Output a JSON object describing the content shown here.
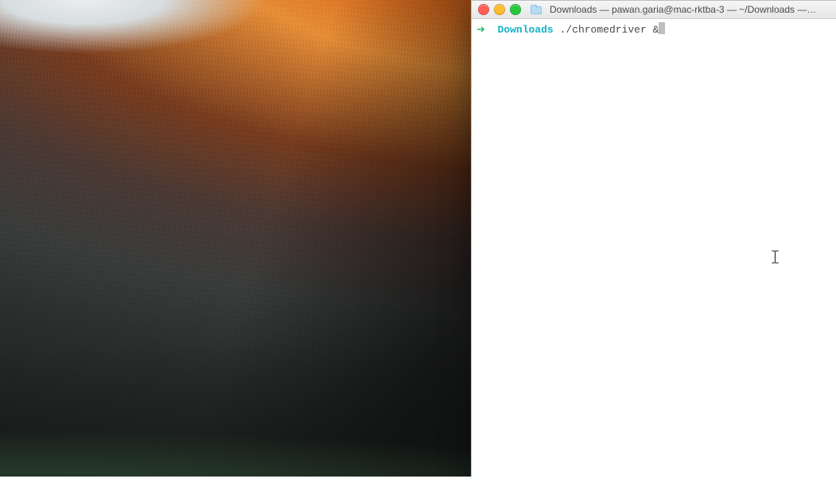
{
  "window": {
    "title": "Downloads — pawan.garia@mac-rktba-3 — ~/Downloads —…",
    "folder_icon": "folder-icon",
    "traffic_lights": {
      "close": "#ff5f57",
      "minimize": "#febc2e",
      "zoom": "#28c840"
    }
  },
  "terminal": {
    "prompt": {
      "arrow": "➜",
      "cwd": "Downloads",
      "command": "./chromedriver &"
    },
    "cursor": "block",
    "text_cursor_glyph": "I"
  }
}
